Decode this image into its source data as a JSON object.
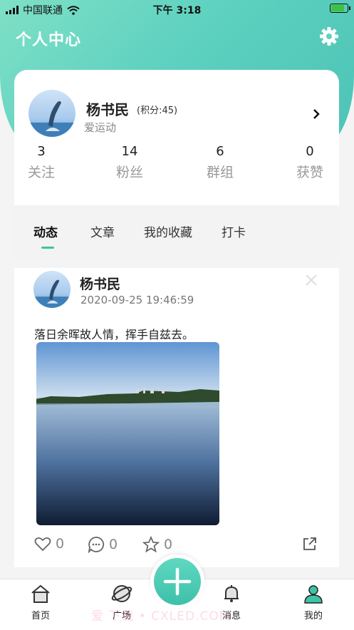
{
  "status_bar": {
    "carrier": "中国联通",
    "time": "下午 3:18",
    "battery_level": 0.9
  },
  "header": {
    "title": "个人中心",
    "settings_icon": "gear-icon"
  },
  "profile": {
    "name": "杨书民",
    "points": "(积分:45)",
    "motto": "爱运动",
    "stats": [
      {
        "value": "3",
        "label": "关注"
      },
      {
        "value": "14",
        "label": "粉丝"
      },
      {
        "value": "6",
        "label": "群组"
      },
      {
        "value": "0",
        "label": "获赞"
      }
    ]
  },
  "tabs": [
    {
      "label": "动态",
      "active": true
    },
    {
      "label": "文章",
      "active": false
    },
    {
      "label": "我的收藏",
      "active": false
    },
    {
      "label": "打卡",
      "active": false
    }
  ],
  "post": {
    "author": "杨书民",
    "time": "2020-09-25 19:46:59",
    "text": "落日余晖故人情，挥手自兹去。",
    "likes": "0",
    "comments": "0",
    "favorites": "0"
  },
  "bottom_nav": [
    {
      "label": "首页",
      "icon": "home-icon"
    },
    {
      "label": "广场",
      "icon": "planet-icon"
    },
    {
      "label": "消息",
      "icon": "bell-icon"
    },
    {
      "label": "我的",
      "icon": "user-icon"
    }
  ],
  "watermark": "爱 下载 • CXLED.COM",
  "colors": {
    "accent": "#3cc4a6",
    "header_gradient_start": "#7fe0c6",
    "header_gradient_end": "#4cc3b6"
  }
}
